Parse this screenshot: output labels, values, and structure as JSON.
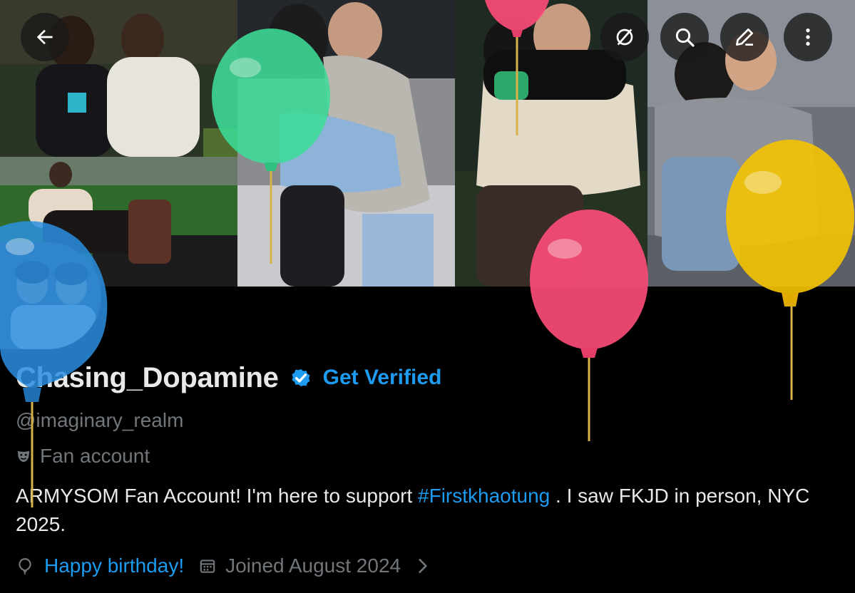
{
  "header": {
    "back_icon": "arrow-left-icon",
    "actions": [
      "circle-slash-icon",
      "search-icon",
      "edit-icon",
      "more-vertical-icon"
    ]
  },
  "profile": {
    "display_name": "Chasing_Dopamine",
    "get_verified_label": "Get Verified",
    "handle": "@imaginary_realm",
    "category": "Fan account",
    "bio": {
      "before": "ARMYSOM Fan Account! I'm here to support ",
      "hashtag": "#Firstkhaotung",
      "after": " . I saw FKJD in person, NYC 2025."
    },
    "birthday": "Happy birthday!",
    "joined": "Joined August 2024"
  },
  "colors": {
    "accent": "#1d9bf0",
    "text": "#e7e9ea",
    "muted": "#71767b",
    "background": "#000000",
    "balloon_green": "#3ddc97",
    "balloon_pink": "#ff4d7a",
    "balloon_yellow": "#f5c400",
    "balloon_blue": "#2b8fe0"
  }
}
